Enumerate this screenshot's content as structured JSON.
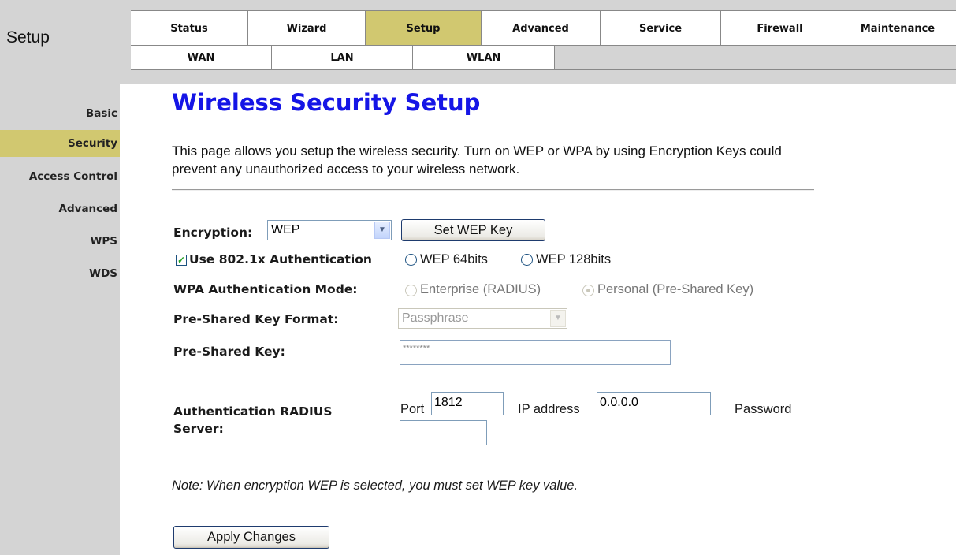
{
  "header": {
    "section_title": "Setup",
    "main_tabs": [
      {
        "label": "Status"
      },
      {
        "label": "Wizard"
      },
      {
        "label": "Setup",
        "active": true
      },
      {
        "label": "Advanced"
      },
      {
        "label": "Service"
      },
      {
        "label": "Firewall"
      },
      {
        "label": "Maintenance"
      }
    ],
    "sub_tabs": [
      {
        "label": "WAN"
      },
      {
        "label": "LAN"
      },
      {
        "label": "WLAN"
      }
    ]
  },
  "sidebar": {
    "items": [
      {
        "label": "Basic"
      },
      {
        "label": "Security",
        "active": true
      },
      {
        "label": "Access Control"
      },
      {
        "label": "Advanced"
      },
      {
        "label": "WPS"
      },
      {
        "label": "WDS"
      }
    ]
  },
  "page": {
    "title": "Wireless Security Setup",
    "description": "This page allows you setup the wireless security. Turn on WEP or WPA by using Encryption Keys could prevent any unauthorized access to your wireless network."
  },
  "form": {
    "encryption_label": "Encryption:",
    "encryption_value": "WEP",
    "set_wep_key_button": "Set WEP Key",
    "use_8021x_label": "Use 802.1x Authentication",
    "use_8021x_checked": true,
    "wep64_label": "WEP 64bits",
    "wep128_label": "WEP 128bits",
    "wpa_auth_mode_label": "WPA Authentication Mode:",
    "wpa_enterprise_label": "Enterprise (RADIUS)",
    "wpa_personal_label": "Personal (Pre-Shared Key)",
    "psk_format_label": "Pre-Shared Key Format:",
    "psk_format_value": "Passphrase",
    "psk_label": "Pre-Shared Key:",
    "psk_value": "********",
    "radius_label": "Authentication RADIUS Server:",
    "radius_port_label": "Port",
    "radius_port_value": "1812",
    "radius_ip_label": "IP address",
    "radius_ip_value": "0.0.0.0",
    "radius_password_label": "Password",
    "radius_password_value": ""
  },
  "note": "Note: When encryption WEP is selected, you must set WEP key value.",
  "apply_button": "Apply Changes",
  "colors": {
    "title_blue": "#1515e6",
    "active_tab": "#d1c870",
    "chrome_gray": "#d4d4d4"
  }
}
